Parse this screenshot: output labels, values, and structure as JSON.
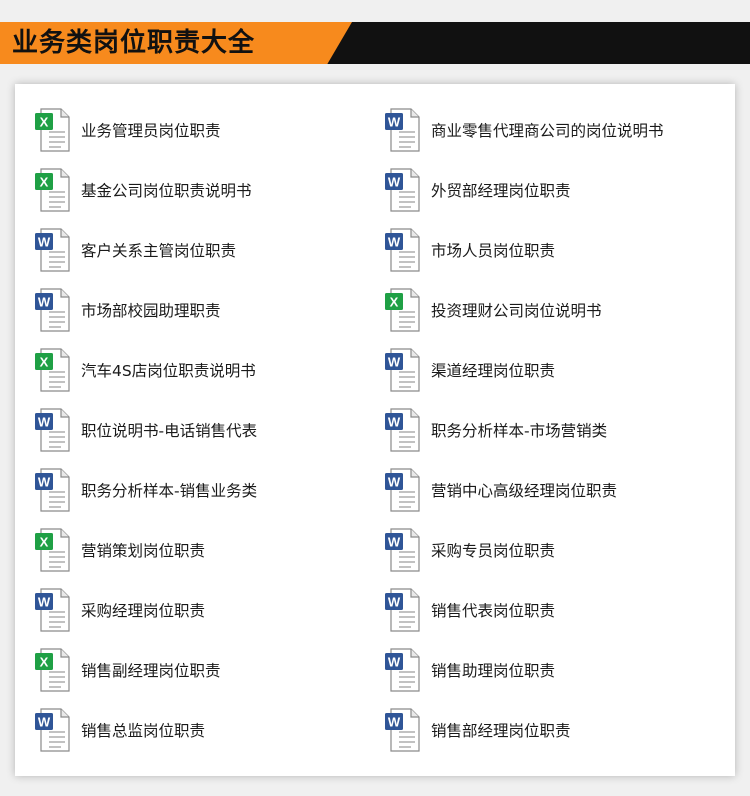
{
  "banner": {
    "title": "业务类岗位职责大全"
  },
  "colors": {
    "banner_orange": "#f78a1d",
    "banner_black": "#111111",
    "excel_green": "#1fa045",
    "word_blue": "#2f5597"
  },
  "left_items": [
    {
      "label": "业务管理员岗位职责",
      "icon": "excel-file-icon"
    },
    {
      "label": "基金公司岗位职责说明书",
      "icon": "excel-file-icon"
    },
    {
      "label": "客户关系主管岗位职责",
      "icon": "word-file-icon"
    },
    {
      "label": "市场部校园助理职责",
      "icon": "word-file-icon"
    },
    {
      "label": "汽车4S店岗位职责说明书",
      "icon": "excel-file-icon"
    },
    {
      "label": "职位说明书-电话销售代表",
      "icon": "word-file-icon"
    },
    {
      "label": "职务分析样本-销售业务类",
      "icon": "word-file-icon"
    },
    {
      "label": "营销策划岗位职责",
      "icon": "excel-file-icon"
    },
    {
      "label": "采购经理岗位职责",
      "icon": "word-file-icon"
    },
    {
      "label": "销售副经理岗位职责",
      "icon": "excel-file-icon"
    },
    {
      "label": "销售总监岗位职责",
      "icon": "word-file-icon"
    }
  ],
  "right_items": [
    {
      "label": "商业零售代理商公司的岗位说明书",
      "icon": "word-file-icon"
    },
    {
      "label": "外贸部经理岗位职责",
      "icon": "word-file-icon"
    },
    {
      "label": "市场人员岗位职责",
      "icon": "word-file-icon"
    },
    {
      "label": "投资理财公司岗位说明书",
      "icon": "excel-file-icon"
    },
    {
      "label": "渠道经理岗位职责",
      "icon": "word-file-icon"
    },
    {
      "label": "职务分析样本-市场营销类",
      "icon": "word-file-icon"
    },
    {
      "label": "营销中心高级经理岗位职责",
      "icon": "word-file-icon"
    },
    {
      "label": "采购专员岗位职责",
      "icon": "word-file-icon"
    },
    {
      "label": "销售代表岗位职责",
      "icon": "word-file-icon"
    },
    {
      "label": "销售助理岗位职责",
      "icon": "word-file-icon"
    },
    {
      "label": "销售部经理岗位职责",
      "icon": "word-file-icon"
    }
  ]
}
